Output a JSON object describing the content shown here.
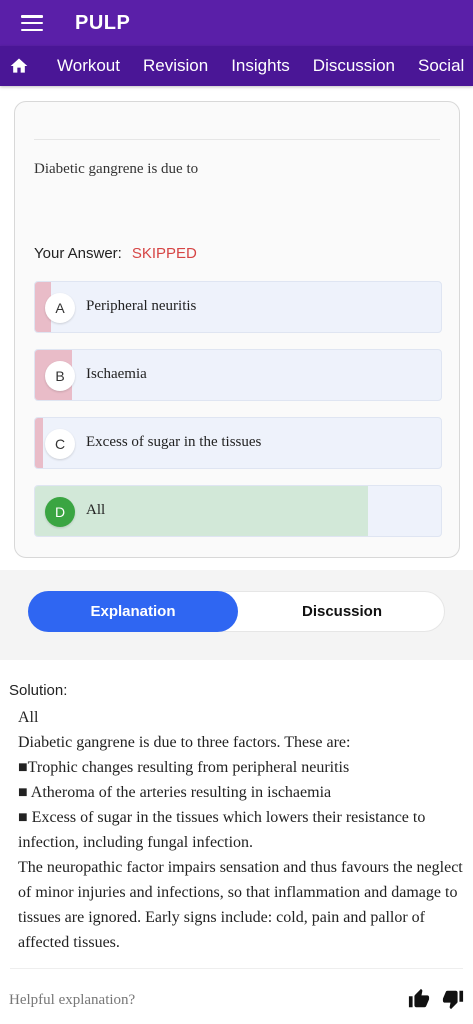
{
  "app": {
    "title": "PULP"
  },
  "nav": {
    "tabs": [
      "Workout",
      "Revision",
      "Insights",
      "Discussion",
      "Social"
    ]
  },
  "question": {
    "text": "Diabetic gangrene is due to",
    "your_answer_label": "Your Answer:",
    "your_answer_value": "SKIPPED",
    "options": [
      {
        "letter": "A",
        "text": "Peripheral neuritis",
        "correct": false,
        "response_fraction": 0.04
      },
      {
        "letter": "B",
        "text": "Ischaemia",
        "correct": false,
        "response_fraction": 0.09
      },
      {
        "letter": "C",
        "text": "Excess of sugar in the tissues",
        "correct": false,
        "response_fraction": 0.02
      },
      {
        "letter": "D",
        "text": "All",
        "correct": true,
        "response_fraction": 0.82
      }
    ]
  },
  "colors": {
    "appbar": "#5a1fa8",
    "navbar": "#4a1696",
    "wrong_fill": "#e9bcc8",
    "correct_fill": "#d2e8d8",
    "correct_badge": "#3aa542",
    "skipped": "#d64545",
    "toggle_active": "#2f66f2"
  },
  "toggle": {
    "explanation": "Explanation",
    "discussion": "Discussion"
  },
  "solution": {
    "label": "Solution:",
    "lines": [
      "All",
      "Diabetic gangrene is due to three factors. These are:",
      "■Trophic changes resulting from peripheral neuritis",
      "■ Atheroma of the arteries resulting in ischaemia",
      "■ Excess of sugar in the tissues which lowers their resistance to infection, including fungal infection.",
      "The neuropathic factor impairs sensation and thus favours the neglect of minor injuries and infections, so that inflammation and damage to tissues are ignored. Early signs include: cold, pain and pallor of affected tissues."
    ]
  },
  "feedback": {
    "prompt": "Helpful explanation?"
  }
}
